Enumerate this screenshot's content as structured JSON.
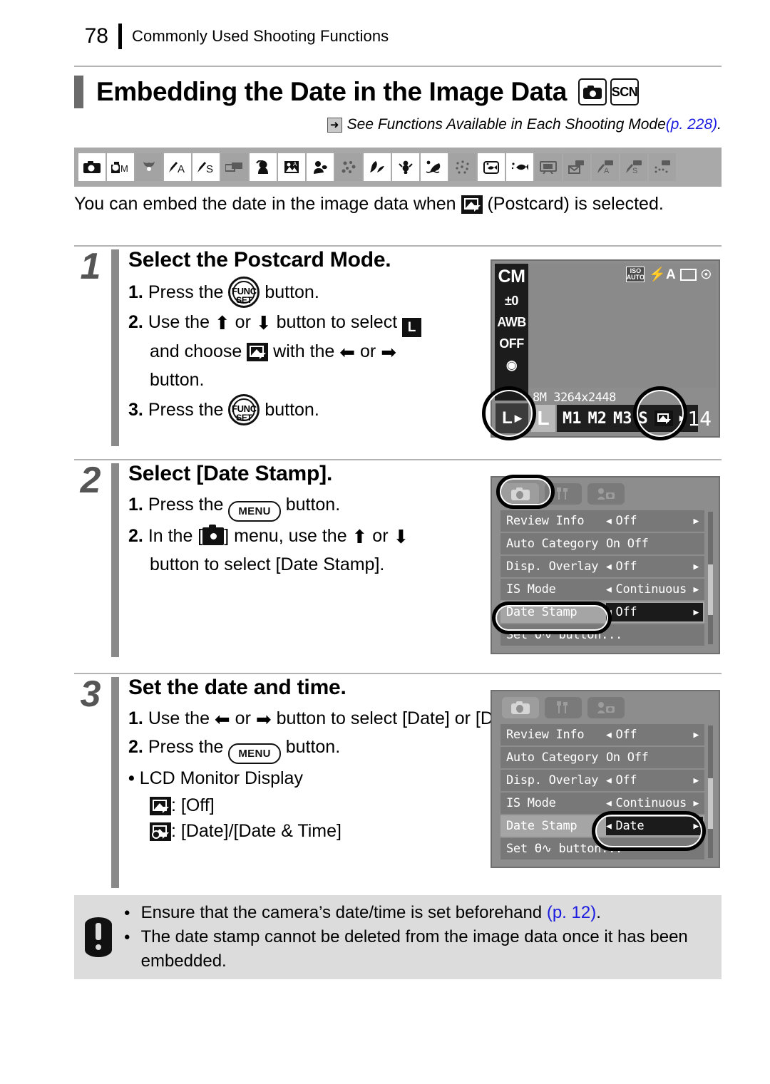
{
  "header": {
    "page_number": "78",
    "chapter": "Commonly Used Shooting Functions"
  },
  "title": {
    "text": "Embedding the Date in the Image Data",
    "badges": [
      {
        "name": "camera-mode-badge",
        "label": ""
      },
      {
        "name": "scn-mode-badge",
        "label": "SCN"
      }
    ]
  },
  "xref": {
    "arrow": "➜",
    "text": "See Functions Available in Each Shooting Mode ",
    "page_ref": "(p. 228)",
    "period": "."
  },
  "mode_strip": {
    "icons": [
      {
        "name": "auto-mode-icon",
        "available": true,
        "glyph": "camera"
      },
      {
        "name": "manual-mode-icon",
        "available": true,
        "glyph": "cam-m"
      },
      {
        "name": "digital-macro-icon",
        "available": false,
        "glyph": "tulip"
      },
      {
        "name": "av-mode-icon",
        "available": true,
        "glyph": "pen-a"
      },
      {
        "name": "tv-mode-icon",
        "available": true,
        "glyph": "pen-s"
      },
      {
        "name": "stitch-assist-icon",
        "available": false,
        "glyph": "stitch"
      },
      {
        "name": "portrait-icon",
        "available": true,
        "glyph": "portrait"
      },
      {
        "name": "night-snapshot-icon",
        "available": true,
        "glyph": "night"
      },
      {
        "name": "kids-and-pets-icon",
        "available": true,
        "glyph": "kids"
      },
      {
        "name": "indoor-icon",
        "available": false,
        "glyph": "indoor"
      },
      {
        "name": "foliage-icon",
        "available": true,
        "glyph": "foliage"
      },
      {
        "name": "snow-icon",
        "available": true,
        "glyph": "snow"
      },
      {
        "name": "beach-icon",
        "available": true,
        "glyph": "beach"
      },
      {
        "name": "fireworks-icon",
        "available": false,
        "glyph": "fireworks"
      },
      {
        "name": "aquarium-icon",
        "available": true,
        "glyph": "aquarium"
      },
      {
        "name": "underwater-icon",
        "available": true,
        "glyph": "underwater"
      },
      {
        "name": "movie-standard-icon",
        "available": false,
        "glyph": "movie"
      },
      {
        "name": "movie-compact-icon",
        "available": false,
        "glyph": "movie-mail"
      },
      {
        "name": "movie-av-icon",
        "available": false,
        "glyph": "movie-a"
      },
      {
        "name": "movie-tv-icon",
        "available": false,
        "glyph": "movie-s"
      },
      {
        "name": "movie-color-icon",
        "available": false,
        "glyph": "movie-dots"
      }
    ]
  },
  "intro": {
    "part1": "You can embed the date in the image data when ",
    "part2": " (Postcard) is selected."
  },
  "steps": [
    {
      "number": "1",
      "title": "Select the Postcard Mode.",
      "lines": [
        {
          "label": "1.",
          "t1": "Press the ",
          "icon": "func-set-button",
          "t2": " button."
        },
        {
          "label": "2.",
          "t1": "Use the ",
          "icon": "up-down-arrows",
          "t2": " button to select ",
          "icon2": "large-size-icon",
          "t3": " and choose ",
          "icon3": "postcard-icon",
          "t4": " with the ",
          "icon4": "left-right-arrows",
          "t5": " button."
        },
        {
          "label": "3.",
          "t1": "Press the ",
          "icon": "func-set-button",
          "t2": " button."
        }
      ]
    },
    {
      "number": "2",
      "title": "Select [Date Stamp].",
      "lines": [
        {
          "label": "1.",
          "t1": "Press the ",
          "icon": "menu-button",
          "t2": " button."
        },
        {
          "label": "2.",
          "t1": "In the [",
          "icon": "shooting-menu-icon",
          "t2": "] menu, use the ",
          "icon2": "up-down-arrows",
          "t3": " button to select [Date Stamp]."
        }
      ]
    },
    {
      "number": "3",
      "title": "Set the date and time.",
      "lines": [
        {
          "label": "1.",
          "t1": "Use the ",
          "icon": "left-right-arrows",
          "t2": " button to select [Date] or [Date & Time]."
        },
        {
          "label": "2.",
          "t1": "Press the ",
          "icon": "menu-button",
          "t2": " button."
        },
        {
          "label": "•",
          "t1": "LCD Monitor Display"
        }
      ],
      "display_legend": [
        {
          "icon": "postcard-icon",
          "value": ": [Off]"
        },
        {
          "icon": "postcard-date-icon",
          "value": ": [Date]/[Date & Time]"
        }
      ]
    }
  ],
  "lcd_screen": {
    "mode_label": "CM",
    "sidebar": [
      "±0",
      "AWB",
      "OFF",
      "metering"
    ],
    "top_icons": [
      "ISO AUTO",
      "flash-auto",
      "single-frame",
      "camera-shake"
    ],
    "iso_line1": "ISO",
    "iso_line2": "AUTO",
    "info_line": "8M 3264x2448",
    "selected_size": "L",
    "size_options": [
      "L",
      "M1",
      "M2",
      "M3",
      "S"
    ],
    "shots_remaining": "14"
  },
  "menu_screen_1": {
    "tabs": [
      "shooting-tab",
      "setup-tab",
      "my-camera-tab"
    ],
    "rows": [
      {
        "label": "Review Info",
        "value": "Off",
        "arrows": true,
        "selected": false,
        "dark": false
      },
      {
        "label": "Auto Category",
        "value": "On Off",
        "arrows": false,
        "selected": false,
        "dark": false
      },
      {
        "label": "Disp. Overlay",
        "value": "Off",
        "arrows": true,
        "selected": false,
        "dark": false
      },
      {
        "label": "IS Mode",
        "value": "Continuous",
        "arrows": true,
        "selected": false,
        "dark": false
      },
      {
        "label": "Date Stamp",
        "value": "Off",
        "arrows": true,
        "selected": true,
        "dark": true
      },
      {
        "label": "Set Ө∿ button...",
        "value": "",
        "arrows": false,
        "selected": false,
        "dark": false
      }
    ],
    "highlight": [
      "shooting-tab",
      "date-stamp-label"
    ]
  },
  "menu_screen_2": {
    "tabs": [
      "shooting-tab",
      "setup-tab",
      "my-camera-tab"
    ],
    "rows": [
      {
        "label": "Review Info",
        "value": "Off",
        "arrows": true,
        "selected": false,
        "dark": false
      },
      {
        "label": "Auto Category",
        "value": "On Off",
        "arrows": false,
        "selected": false,
        "dark": false
      },
      {
        "label": "Disp. Overlay",
        "value": "Off",
        "arrows": true,
        "selected": false,
        "dark": false
      },
      {
        "label": "IS Mode",
        "value": "Continuous",
        "arrows": true,
        "selected": false,
        "dark": false
      },
      {
        "label": "Date Stamp",
        "value": "Date",
        "arrows": true,
        "selected": true,
        "dark": true
      },
      {
        "label": "Set Ө∿ button...",
        "value": "",
        "arrows": false,
        "selected": false,
        "dark": false
      }
    ],
    "highlight": [
      "date-stamp-value"
    ]
  },
  "caution": {
    "bullet1_text": "Ensure that the camera’s date/time is set beforehand ",
    "bullet1_ref": "(p. 12)",
    "bullet1_end": ".",
    "bullet2_text": "The date stamp cannot be deleted from the image data once it has been embedded."
  },
  "colors": {
    "link": "#1c1ce0",
    "strip_bg": "#a9a9a9",
    "caution_bg": "#dcdcdc",
    "rule": "#b4b4b4"
  }
}
